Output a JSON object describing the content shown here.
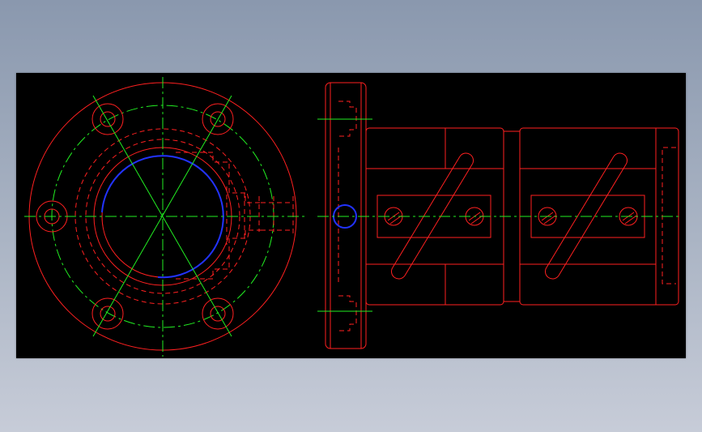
{
  "viewport": {
    "background_top": "#8a98ae",
    "background_bottom": "#c7ccd8",
    "canvas_background": "#000000"
  },
  "drawing": {
    "views": [
      "front-view-flange",
      "side-view-coupling"
    ],
    "colors": {
      "outline": "#ff2020",
      "centerline": "#22ee22",
      "highlight": "#2233ff"
    },
    "flange_bolt_hole_count": 6,
    "coupling_pin_count": 4
  }
}
